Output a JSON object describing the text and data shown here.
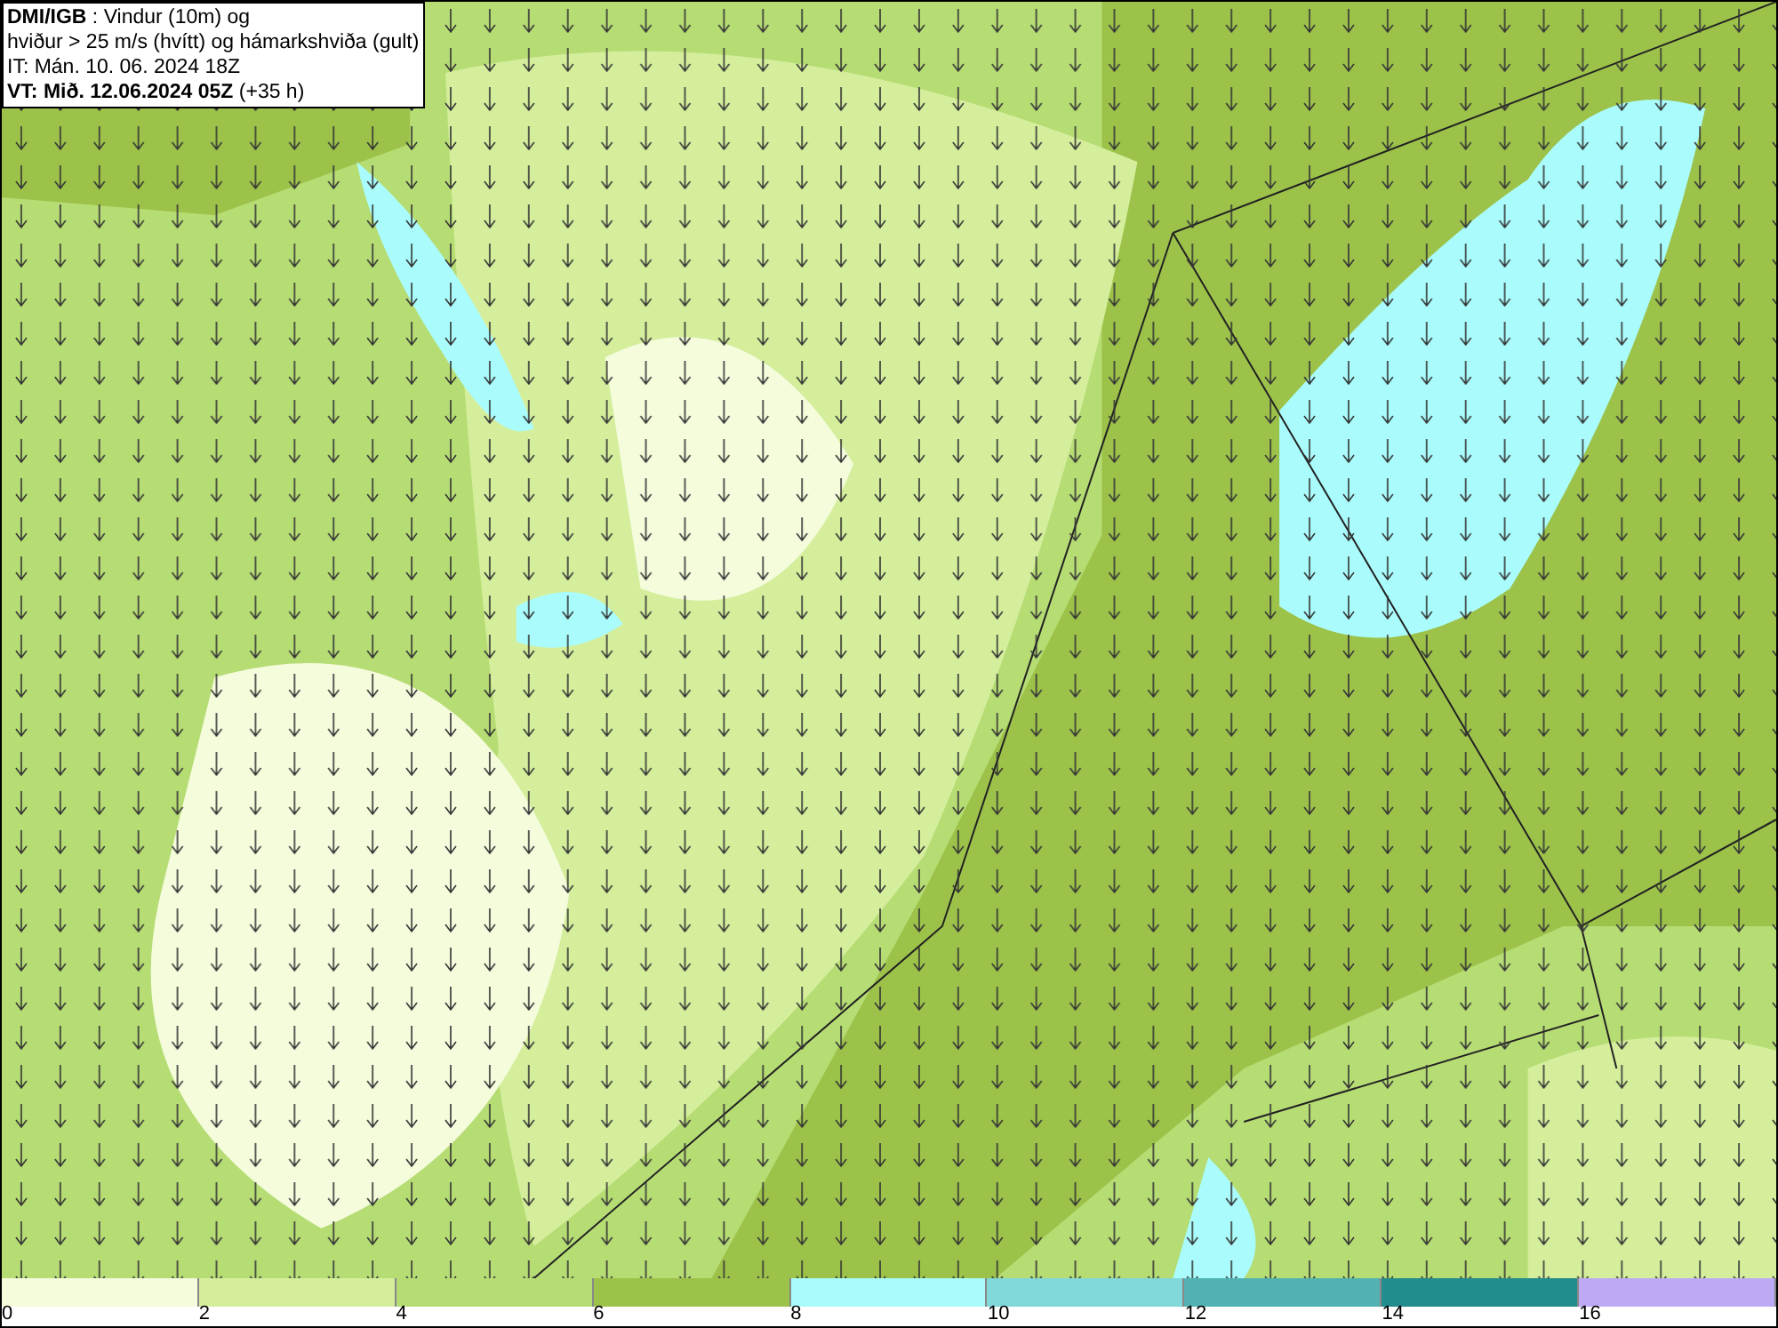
{
  "info_box": {
    "lines": [
      "**DMI/IGB** : Vindur (10m) og",
      "hviður > 25 m/s (hvítt) og hámarkshviða (gult)",
      "IT: Mán. 10. 06. 2024 18Z",
      "**VT: Mið. 12.06.2024 05Z** (+35 h)"
    ]
  },
  "legend": {
    "segments": [
      {
        "color": "#f4fcdc",
        "label": "0"
      },
      {
        "color": "#d4ee9c",
        "label": "2"
      },
      {
        "color": "#b6dc74",
        "label": "4"
      },
      {
        "color": "#9cc24a",
        "label": "6"
      },
      {
        "color": "#aafcfc",
        "label": "8"
      },
      {
        "color": "#80d8d8",
        "label": "10"
      },
      {
        "color": "#52b2b2",
        "label": "12"
      },
      {
        "color": "#238c8c",
        "label": "14"
      },
      {
        "color": "#beaaf4",
        "label": "16"
      }
    ]
  }
}
